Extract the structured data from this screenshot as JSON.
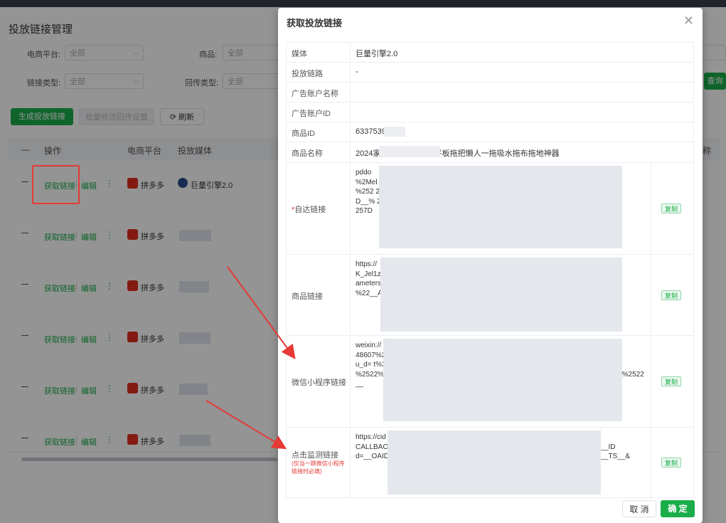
{
  "page": {
    "title": "投放链接管理",
    "filters": [
      {
        "label": "电商平台:",
        "value": "全部"
      },
      {
        "label": "商品:",
        "value": "全部"
      },
      {
        "label": "链接类型:",
        "value": "全部"
      },
      {
        "label": "回传类型:",
        "value": "全部"
      }
    ],
    "buttons": {
      "generate": "生成投放链接",
      "batch_edit": "批量修改回传设置",
      "refresh": "刷新",
      "query": "查询"
    },
    "table_headers": {
      "op": "操作",
      "platform": "电商平台",
      "media": "投放媒体",
      "extra": "称"
    },
    "rows": [
      {
        "op_get": "获取链接",
        "op_sep": "|",
        "op_edit": "编辑",
        "op_more": "⋮",
        "platform": "拼多多",
        "media": "巨量引擎2.0"
      },
      {
        "op_get": "获取链接",
        "op_sep": "|",
        "op_edit": "编辑",
        "op_more": "⋮",
        "platform": "拼多多"
      },
      {
        "op_get": "获取链接",
        "op_sep": "|",
        "op_edit": "编辑",
        "op_more": "⋮",
        "platform": "拼多多"
      },
      {
        "op_get": "获取链接",
        "op_sep": "|",
        "op_edit": "编辑",
        "op_more": "⋮",
        "platform": "拼多多"
      },
      {
        "op_get": "获取链接",
        "op_sep": "|",
        "op_edit": "编辑",
        "op_more": "⋮",
        "platform": "拼多多"
      },
      {
        "op_get": "获取链接",
        "op_sep": "|",
        "op_edit": "编辑",
        "op_more": "⋮",
        "platform": "拼多多"
      }
    ]
  },
  "dialog": {
    "title": "获取投放链接",
    "close": "✕",
    "rows": {
      "media": {
        "label": "媒体",
        "value": "巨量引擎2.0"
      },
      "link_path": {
        "label": "投放链路",
        "value": "-"
      },
      "ad_account_name": {
        "label": "广告账户名称",
        "value": ""
      },
      "ad_account_id": {
        "label": "广告账户ID",
        "value": ""
      },
      "product_id": {
        "label": "商品ID",
        "value": "6337539"
      },
      "product_name": {
        "label": "商品名称",
        "value": "2024家                     用平板拖把懒人一拖吸水拖布拖地神器"
      },
      "self_link": {
        "required": "*",
        "label": "自达链接",
        "value": "pddo                                                               %3Fgo ods_id                                                              %2Mel gok1g2                                                              2923 48607_                                                             %252 2%253A                                                             %257 B%2522v                                                            D__% 2522                                                              MOTI CN_I                                                            257D",
        "copy": "复制"
      },
      "product_link": {
        "label": "商品链接",
        "value": "https://                                                          097529&pi d=4122                                                           K_Jel1zD 4=58rp                                                           ad2635 &_x_do                                                            ameters =%7B9                                                            k%22%3 A169                                                          %22__ADVER TISER_I",
        "copy": "复制"
      },
      "wechat_link": {
        "label": "微信小程序链接",
        "value": "weixin://                                                        coupon/w elfare_                                                          48607%2 6goods                                                           n%3DC C_2410                                                           u_d= t%3D%                                                           26cust omPara                                                          %2522% 253A16                                                         %252C%25 22rd%2522%253A%2522__",
        "copy": "复制"
      },
      "monitor_link": {
        "label": "点击监测链接",
        "note": "(仅当一跳微信小程序链接时必填)",
        "value": "https://cid                                                      ion=100062 &uid=663                                                         CALLBAC K_PARAM_                                                        ei=__IMEI_ _&idfa=__ID                                                       d=__OAID_ _&oaid_md                                                        &ua=__UA__ &ts=__TS__&",
        "copy": "复制"
      }
    },
    "cancel": "取 消",
    "ok": "确 定"
  },
  "colors": {
    "accent": "#1aad4a",
    "danger": "#e53935",
    "overlay": "rgba(0,0,0,0.42)"
  }
}
